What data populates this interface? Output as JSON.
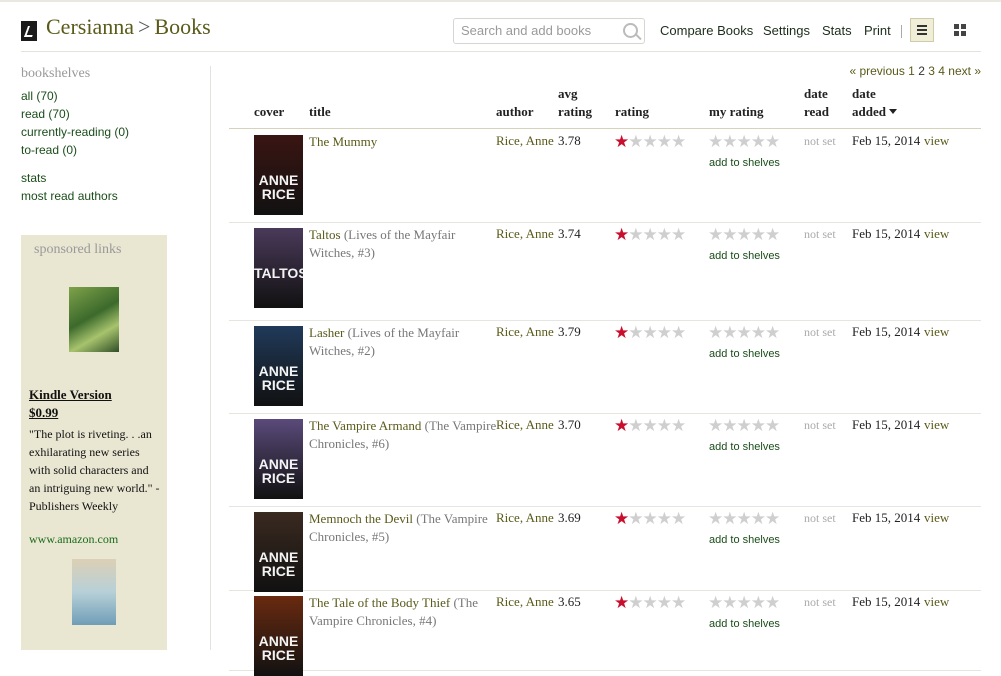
{
  "header": {
    "breadcrumb_user": "Cersianna",
    "breadcrumb_sep": ">",
    "breadcrumb_section": "Books",
    "search_placeholder": "Search and add books",
    "nav": [
      "Compare Books",
      "Settings",
      "Stats",
      "Print"
    ]
  },
  "sidebar": {
    "heading": "bookshelves",
    "shelves": [
      "all (70)",
      "read (70)",
      "currently-reading (0)",
      "to-read (0)"
    ],
    "extras": [
      "stats",
      "most read authors"
    ],
    "sponsored": {
      "heading": "sponsored links",
      "title": "Kindle Version",
      "price": "$0.99",
      "quote": "\"The plot is riveting. . .an exhilarating new series with solid characters and an intriguing new world.\" - Publishers Weekly",
      "link": "www.amazon.com"
    }
  },
  "pagination": {
    "prev": "« previous",
    "pages": [
      "1",
      "2",
      "3",
      "4"
    ],
    "current": "2",
    "next": "next »"
  },
  "columns": {
    "cover": "cover",
    "title": "title",
    "author": "author",
    "avg_line1": "avg",
    "avg_line2": "rating",
    "rating": "rating",
    "my_rating": "my rating",
    "read_line1": "date",
    "read_line2": "read",
    "added_line1": "date",
    "added_line2": "added"
  },
  "books": [
    {
      "title": "The Mummy",
      "series": "",
      "author": "Rice, Anne",
      "avg": "3.78",
      "rating": 1,
      "read": "not set",
      "added": "Feb 15, 2014",
      "view": "view",
      "shelves": "add to shelves",
      "cover_text": "ANNE RICE",
      "cover_color": "#3a1512"
    },
    {
      "title": "Taltos",
      "series": "(Lives of the Mayfair Witches, #3)",
      "author": "Rice, Anne",
      "avg": "3.74",
      "rating": 1,
      "read": "not set",
      "added": "Feb 15, 2014",
      "view": "view",
      "shelves": "add to shelves",
      "cover_text": "TALTOS",
      "cover_color": "#4a3a5a"
    },
    {
      "title": "Lasher",
      "series": "(Lives of the Mayfair Witches, #2)",
      "author": "Rice, Anne",
      "avg": "3.79",
      "rating": 1,
      "read": "not set",
      "added": "Feb 15, 2014",
      "view": "view",
      "shelves": "add to shelves",
      "cover_text": "ANNE RICE",
      "cover_color": "#203a5a"
    },
    {
      "title": "The Vampire Armand",
      "series": "(The Vampire Chronicles, #6)",
      "author": "Rice, Anne",
      "avg": "3.70",
      "rating": 1,
      "read": "not set",
      "added": "Feb 15, 2014",
      "view": "view",
      "shelves": "add to shelves",
      "cover_text": "ANNE RICE",
      "cover_color": "#5a4a7a"
    },
    {
      "title": "Memnoch the Devil",
      "series": "(The Vampire Chronicles, #5)",
      "author": "Rice, Anne",
      "avg": "3.69",
      "rating": 1,
      "read": "not set",
      "added": "Feb 15, 2014",
      "view": "view",
      "shelves": "add to shelves",
      "cover_text": "ANNE RICE",
      "cover_color": "#3a2a20"
    },
    {
      "title": "The Tale of the Body Thief",
      "series": "(The Vampire Chronicles, #4)",
      "author": "Rice, Anne",
      "avg": "3.65",
      "rating": 1,
      "read": "not set",
      "added": "Feb 15, 2014",
      "view": "view",
      "shelves": "add to shelves",
      "cover_text": "ANNE RICE",
      "cover_color": "#6a2a10"
    }
  ]
}
